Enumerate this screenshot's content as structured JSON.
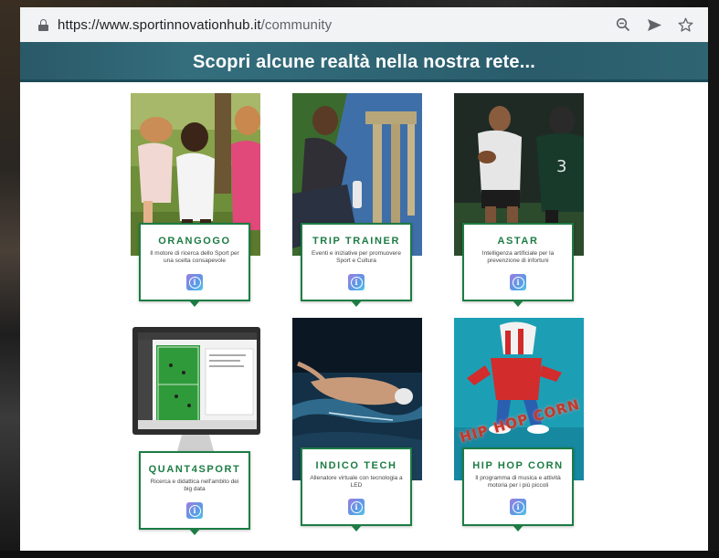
{
  "browser": {
    "url_domain": "https://www.sportinnovationhub.it",
    "url_path": "/community",
    "icons": [
      "lock-icon",
      "zoom-icon",
      "send-icon",
      "star-icon"
    ]
  },
  "banner": {
    "title": "Scopri alcune realtà nella nostra rete..."
  },
  "colors": {
    "accent": "#1c7c44",
    "banner": "#2f6675"
  },
  "cards": [
    {
      "name": "ORANGOGO",
      "desc": "Il motore di ricerca dello Sport per una scelta consapevole"
    },
    {
      "name": "TRIP TRAINER",
      "desc": "Eventi e iniziative per promuovere Sport e Cultura"
    },
    {
      "name": "ASTAR",
      "desc": "Intelligenza artificiale per la prevenzione di infortuni"
    },
    {
      "name": "QUANT4SPORT",
      "desc": "Ricerca e didattica nell'ambito dei big data"
    },
    {
      "name": "INDICO TECH",
      "desc": "Allenatore virtuale con tecnologia a LED"
    },
    {
      "name": "HIP HOP CORN",
      "desc": "Il programma di musica e attività motoria per i più piccoli",
      "logo_text": "HIP HOP CORN"
    }
  ]
}
